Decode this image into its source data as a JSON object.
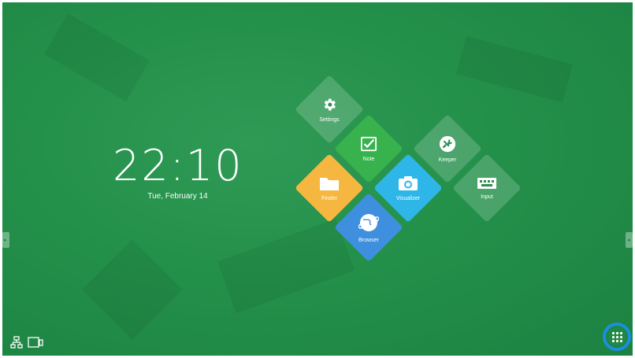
{
  "clock": {
    "time": "22:10",
    "date": "Tue, February 14"
  },
  "tiles": [
    {
      "label": "Settings",
      "color": "rgba(255,255,255,0.18)",
      "icon": "gear-icon"
    },
    {
      "label": "Note",
      "color": "#37b24d",
      "icon": "note-icon"
    },
    {
      "label": "Keeper",
      "color": "rgba(255,255,255,0.18)",
      "icon": "keeper-icon"
    },
    {
      "label": "Finder",
      "color": "#f5b740",
      "icon": "folder-icon"
    },
    {
      "label": "Visualizer",
      "color": "#2fb6e8",
      "icon": "camera-icon"
    },
    {
      "label": "Input",
      "color": "rgba(255,255,255,0.18)",
      "icon": "input-icon"
    },
    {
      "label": "Browser",
      "color": "#3f8fdf",
      "icon": "globe-icon"
    }
  ],
  "bottom_bar": {
    "apps_ring_color": "#1a8fe0"
  }
}
